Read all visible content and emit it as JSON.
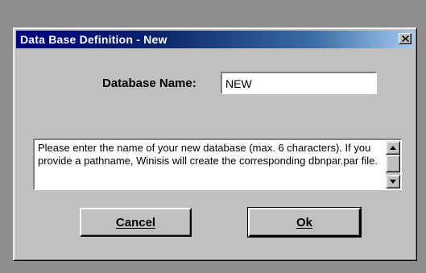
{
  "window": {
    "title": "Data Base Definition - New"
  },
  "form": {
    "name_label": "Database Name:",
    "name_value": "NEW"
  },
  "help": {
    "text": "Please enter the name of your new database (max. 6 characters). If you provide a pathname, Winisis will create the corresponding dbnpar.par file."
  },
  "buttons": {
    "cancel_label": "Cancel",
    "ok_label": "Ok"
  },
  "icons": {
    "close": "close-icon",
    "scroll_up": "arrow-up-icon",
    "scroll_down": "arrow-down-icon"
  },
  "colors": {
    "titlebar_start": "#000080",
    "titlebar_end": "#a6caf0",
    "face": "#c0c0c0",
    "desktop": "#8e8e8e"
  }
}
